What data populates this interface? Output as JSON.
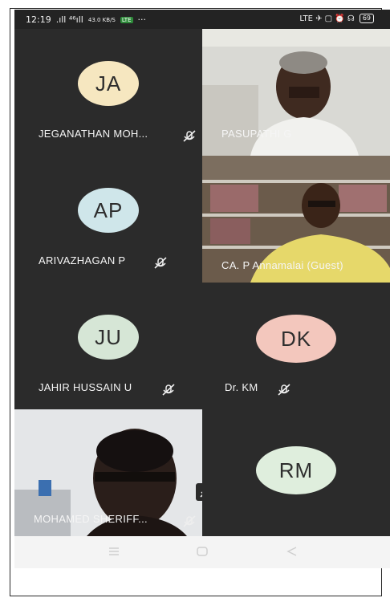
{
  "status_bar": {
    "time": "12:19",
    "signal_text": ".ıll ⁴⁶ıll",
    "speed": "43.0 KB/S",
    "net_badge": "LTE",
    "more": "···",
    "right_icons": "LTE ✈ ▢ ⏰ ☊",
    "battery": "69"
  },
  "participants": [
    {
      "initials": "JA",
      "name": "JEGANATHAN MOH...",
      "avatar_color": "#f6e7c0",
      "muted": true
    },
    {
      "name": "PASUPATHI G",
      "video": true
    },
    {
      "initials": "AP",
      "name": "ARIVAZHAGAN P",
      "avatar_color": "#cfe6ea",
      "muted": true
    },
    {
      "name": "CA. P Annamalai (Guest)",
      "video": true
    },
    {
      "initials": "JU",
      "name": "JAHIR HUSSAIN U",
      "avatar_color": "#d6e6d6",
      "muted": true
    },
    {
      "initials": "DK",
      "name": "Dr. KM",
      "avatar_color": "#f3c7bd",
      "muted": true
    },
    {
      "name": "MOHAMED SHERIFF...",
      "video": true,
      "muted": true
    },
    {
      "initials": "RM",
      "avatar_color": "#dfeedd"
    }
  ],
  "nav": {
    "menu_icon": "menu-icon",
    "home_icon": "home-icon",
    "back_icon": "back-icon"
  }
}
